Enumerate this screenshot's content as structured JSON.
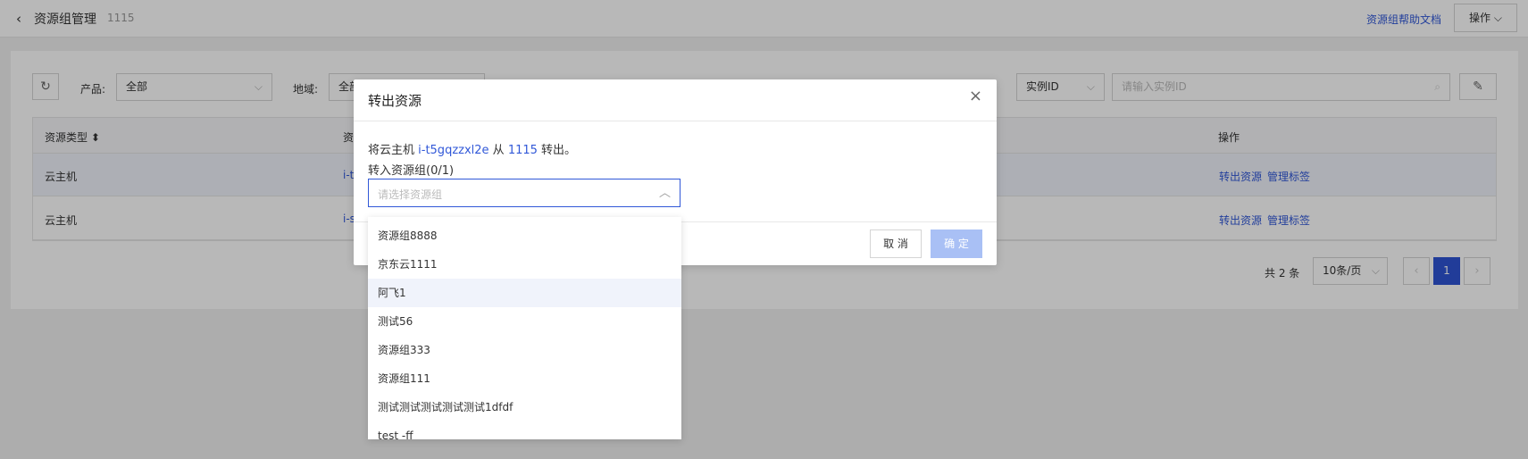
{
  "header": {
    "back_icon": "chevron-left-icon",
    "title": "资源组管理",
    "group_id": "1115",
    "help_link": "资源组帮助文档",
    "ops_button": "操作 ⌵"
  },
  "filters": {
    "refresh_icon": "refresh-icon",
    "product_label": "产品:",
    "product_value": "全部",
    "region_label": "地域:",
    "region_value": "全部",
    "search_field_type": "实例ID",
    "search_placeholder": "请输入实例ID",
    "search_icon": "search-icon",
    "settings_icon": "brush-icon"
  },
  "table": {
    "columns": [
      "资源类型 ⬍",
      "资",
      "操作"
    ],
    "rows": [
      {
        "type": "云主机",
        "id_partial": "i-t",
        "action1": "转出资源",
        "action2": "管理标签"
      },
      {
        "type": "云主机",
        "id_partial": "i-s",
        "action1": "转出资源",
        "action2": "管理标签"
      }
    ]
  },
  "pagination": {
    "total": "共 2 条",
    "page_size": "10条/页",
    "prev": "‹",
    "current": "1",
    "next": "›"
  },
  "modal": {
    "title": "转出资源",
    "close_icon": "close-icon",
    "desc_prefix": "将云主机 ",
    "instance_id": "i-t5gqzzxl2e",
    "desc_mid": " 从 ",
    "source_group": "1115",
    "desc_suffix": " 转出。",
    "target_label": "转入资源组(0/1)",
    "select_placeholder": "请选择资源组",
    "cancel": "取 消",
    "confirm": "确 定"
  },
  "dropdown": {
    "options": [
      "资源组8888",
      "京东云1111",
      "阿飞1",
      "测试56",
      "资源组333",
      "资源组111",
      "测试测试测试测试测试1dfdf",
      "test -ff"
    ],
    "highlighted_index": 2
  },
  "colors": {
    "accent": "#3158d8",
    "primary_button": "#2f54d4",
    "disabled_button": "#a9c0f5"
  }
}
